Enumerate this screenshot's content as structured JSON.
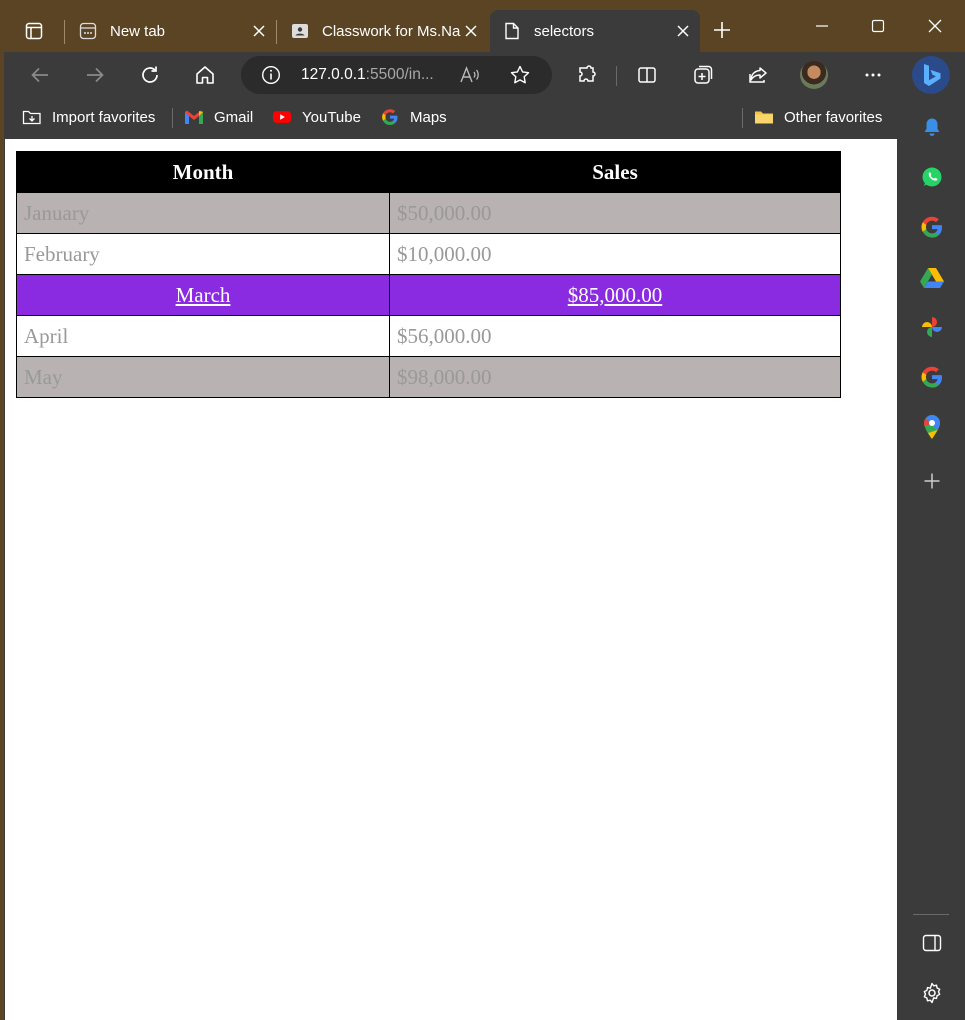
{
  "browser": {
    "tabs": [
      {
        "title": "New tab",
        "icon": "new-tab-page-icon",
        "active": false
      },
      {
        "title": "Classwork for Ms.Na",
        "icon": "classroom-icon",
        "active": false
      },
      {
        "title": "selectors",
        "icon": "document-icon",
        "active": true
      }
    ],
    "address": {
      "host": "127.0.0.1",
      "rest": ":5500/in..."
    },
    "favorites": [
      {
        "label": "Import favorites",
        "icon": "import-icon"
      },
      {
        "label": "Gmail",
        "icon": "gmail-icon"
      },
      {
        "label": "YouTube",
        "icon": "youtube-icon"
      },
      {
        "label": "Maps",
        "icon": "google-icon"
      }
    ],
    "other_favorites": "Other favorites",
    "sidebar_icons": [
      "bell-icon",
      "whatsapp-icon",
      "google-icon",
      "drive-icon",
      "photos-icon",
      "google-icon",
      "maps-pin-icon",
      "add-icon"
    ]
  },
  "page": {
    "table": {
      "headers": [
        "Month",
        "Sales"
      ],
      "rows": [
        {
          "month": "January",
          "sales": "$50,000.00",
          "style": "odd"
        },
        {
          "month": "February",
          "sales": "$10,000.00",
          "style": "even"
        },
        {
          "month": "March",
          "sales": "$85,000.00",
          "style": "highlight"
        },
        {
          "month": "April",
          "sales": "$56,000.00",
          "style": "even"
        },
        {
          "month": "May",
          "sales": "$98,000.00",
          "style": "odd"
        }
      ]
    }
  },
  "colors": {
    "highlight": "#8a2be2",
    "stripe": "#b8b2b2",
    "header": "#000000"
  }
}
